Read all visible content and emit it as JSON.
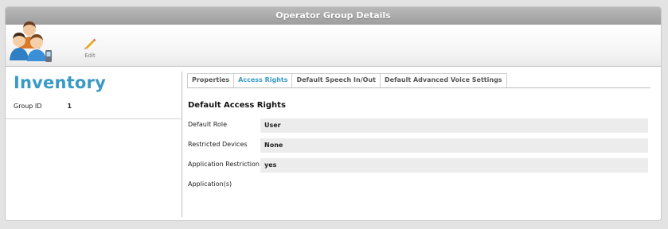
{
  "window": {
    "title": "Operator Group Details"
  },
  "toolbar": {
    "group_icon": "operator-group-icon",
    "edit_icon": "pencil-icon",
    "edit_label": "Edit"
  },
  "left": {
    "title": "Inventory",
    "group_id_label": "Group ID",
    "group_id_value": "1"
  },
  "tabs": [
    {
      "label": "Properties",
      "active": false
    },
    {
      "label": "Access Rights",
      "active": true
    },
    {
      "label": "Default Speech In/Out",
      "active": false
    },
    {
      "label": "Default Advanced Voice Settings",
      "active": false
    }
  ],
  "access": {
    "section_title": "Default Access Rights",
    "fields": [
      {
        "label": "Default Role",
        "value": "User"
      },
      {
        "label": "Restricted Devices",
        "value": "None"
      },
      {
        "label": "Application Restriction",
        "value": "yes"
      },
      {
        "label": "Application(s)",
        "value": ""
      }
    ]
  },
  "colors": {
    "accent": "#3a9ac4",
    "titlebar": "#a9a9a9",
    "field_bg": "#ececec"
  }
}
